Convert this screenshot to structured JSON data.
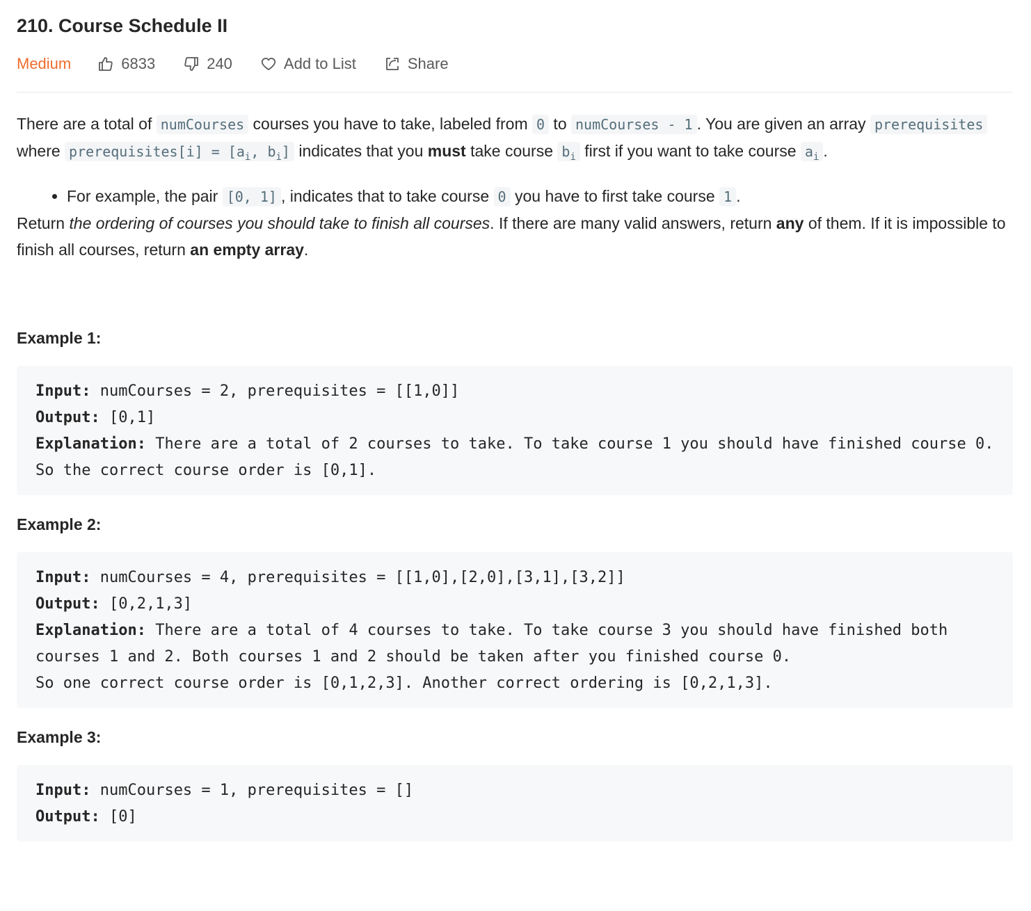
{
  "problem": {
    "title": "210. Course Schedule II",
    "difficulty": "Medium",
    "likes": "6833",
    "dislikes": "240",
    "add_to_list": "Add to List",
    "share": "Share"
  },
  "description": {
    "p1": {
      "t1": "There are a total of ",
      "c1": "numCourses",
      "t2": " courses you have to take, labeled from ",
      "c2": "0",
      "t3": " to ",
      "c3": "numCourses - 1",
      "t4": ". You are given an array ",
      "c4": "prerequisites",
      "t5": " where ",
      "c5a": "prerequisites[i] = [a",
      "c5sub1": "i",
      "c5b": ", b",
      "c5sub2": "i",
      "c5c": "]",
      "t6": " indicates that you ",
      "b1": "must",
      "t7": " take course ",
      "c6": "b",
      "c6sub": "i",
      "t8": " first if you want to take course ",
      "c7": "a",
      "c7sub": "i",
      "t9": "."
    },
    "bullet": {
      "t1": "For example, the pair ",
      "c1": "[0, 1]",
      "t2": ", indicates that to take course ",
      "c2": "0",
      "t3": " you have to first take course ",
      "c3": "1",
      "t4": "."
    },
    "p2": {
      "t1": "Return ",
      "em1": "the ordering of courses you should take to finish all courses",
      "t2": ". If there are many valid answers, return ",
      "b1": "any",
      "t3": " of them. If it is impossible to finish all courses, return ",
      "b2": "an empty array",
      "t4": "."
    }
  },
  "examples": [
    {
      "heading": "Example 1:",
      "input_label": "Input:",
      "input": " numCourses = 2, prerequisites = [[1,0]]",
      "output_label": "Output:",
      "output": " [0,1]",
      "explanation_label": "Explanation:",
      "explanation": " There are a total of 2 courses to take. To take course 1 you should have finished course 0. So the correct course order is [0,1]."
    },
    {
      "heading": "Example 2:",
      "input_label": "Input:",
      "input": " numCourses = 4, prerequisites = [[1,0],[2,0],[3,1],[3,2]]",
      "output_label": "Output:",
      "output": " [0,2,1,3]",
      "explanation_label": "Explanation:",
      "explanation": " There are a total of 4 courses to take. To take course 3 you should have finished both courses 1 and 2. Both courses 1 and 2 should be taken after you finished course 0.\nSo one correct course order is [0,1,2,3]. Another correct ordering is [0,2,1,3]."
    },
    {
      "heading": "Example 3:",
      "input_label": "Input:",
      "input": " numCourses = 1, prerequisites = []",
      "output_label": "Output:",
      "output": " [0]"
    }
  ],
  "colors": {
    "difficulty_medium": "#ef6c2c",
    "code_bg": "#f4f5f7",
    "example_bg": "#f7f8fa"
  },
  "icons": [
    "thumbs-up-icon",
    "thumbs-down-icon",
    "heart-icon",
    "share-icon"
  ]
}
